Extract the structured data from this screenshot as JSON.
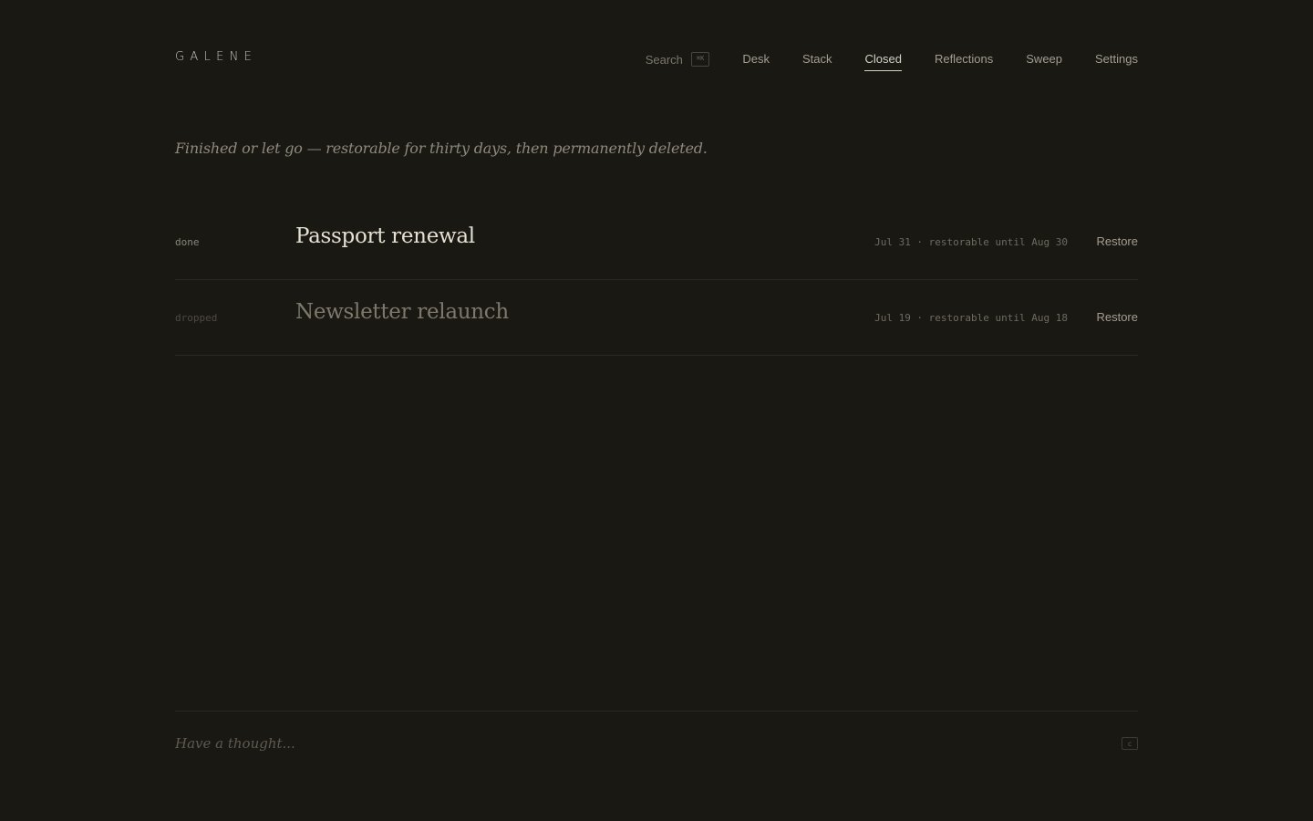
{
  "app": {
    "logo": "GALENE"
  },
  "nav": {
    "search_label": "Search",
    "search_shortcut": "⌘K",
    "items": [
      {
        "label": "Desk"
      },
      {
        "label": "Stack"
      },
      {
        "label": "Closed",
        "active": true
      },
      {
        "label": "Reflections"
      },
      {
        "label": "Sweep"
      },
      {
        "label": "Settings"
      }
    ]
  },
  "intro": "Finished or let go — restorable for thirty days, then permanently deleted.",
  "closed_items": [
    {
      "status": "done",
      "title": "Passport renewal",
      "meta": "Jul 31 · restorable until Aug 30",
      "action": "Restore"
    },
    {
      "status": "dropped",
      "title": "Newsletter relaunch",
      "meta": "Jul 19 · restorable until Aug 18",
      "action": "Restore"
    }
  ],
  "compose": {
    "placeholder": "Have a thought...",
    "shortcut": "c"
  },
  "colors": {
    "background": "#1a1813",
    "text_primary": "#e6e0d3",
    "text_muted": "#8f897d",
    "divider": "#2b2822"
  }
}
